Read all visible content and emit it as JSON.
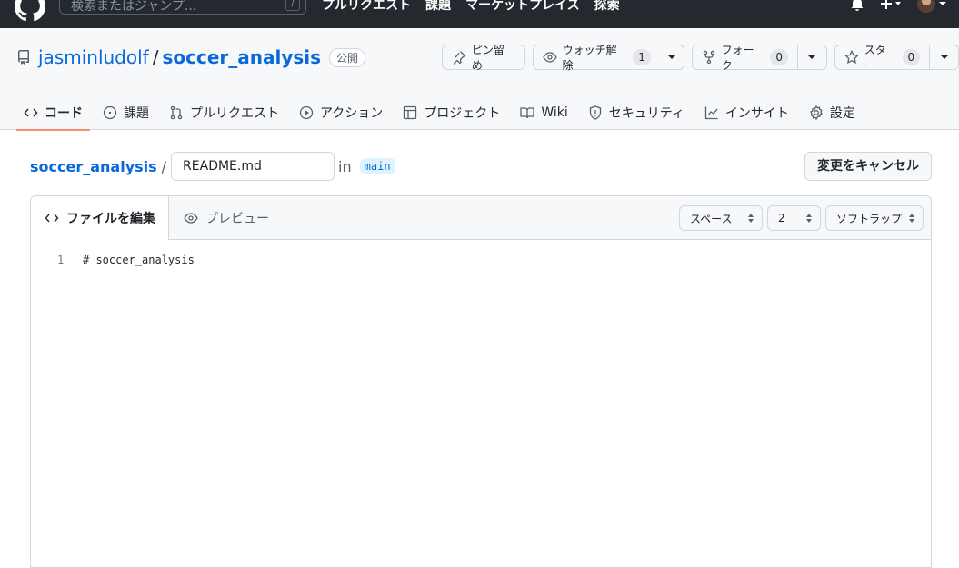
{
  "topbar": {
    "search_placeholder": "検索またはジャンプ...",
    "search_shortcut": "/",
    "nav": [
      "プルリクエスト",
      "課題",
      "マーケットプレイス",
      "探索"
    ]
  },
  "repo": {
    "owner": "jasminludolf",
    "separator": "/",
    "name": "soccer_analysis",
    "visibility": "公開",
    "actions": {
      "pin": "ピン留め",
      "watch": "ウォッチ解除",
      "watch_count": "1",
      "fork": "フォーク",
      "fork_count": "0",
      "star": "スター",
      "star_count": "0"
    },
    "tabs": [
      "コード",
      "課題",
      "プルリクエスト",
      "アクション",
      "プロジェクト",
      "Wiki",
      "セキュリティ",
      "インサイト",
      "設定"
    ]
  },
  "editor": {
    "breadcrumb_repo": "soccer_analysis",
    "breadcrumb_sep": "/",
    "filename": "README.md",
    "in_label": "in",
    "branch": "main",
    "cancel_label": "変更をキャンセル",
    "tab_edit": "ファイルを編集",
    "tab_preview": "プレビュー",
    "indent_mode": "スペース",
    "indent_size": "2",
    "wrap_mode": "ソフトラップ",
    "lines": [
      {
        "number": "1",
        "text": "# soccer_analysis"
      }
    ]
  },
  "colors": {
    "link": "#0969da",
    "topbar": "#24292f",
    "active_tab_underline": "#fd8c73"
  }
}
